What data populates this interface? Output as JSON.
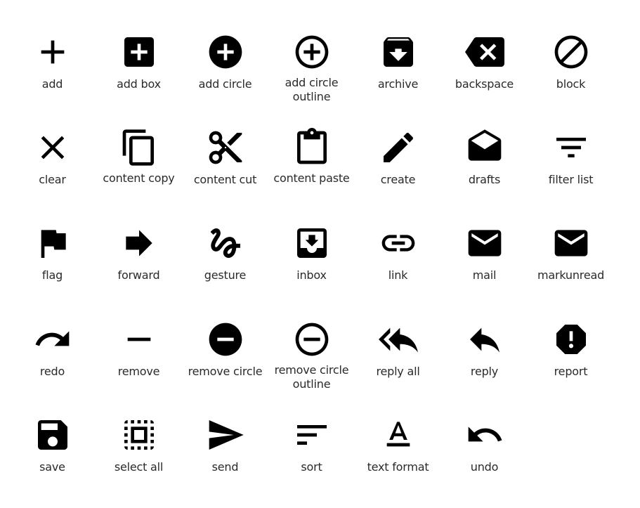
{
  "icons": [
    {
      "id": "add",
      "label": "add",
      "icon": "add-icon"
    },
    {
      "id": "add_box",
      "label": "add box",
      "icon": "add-box-icon"
    },
    {
      "id": "add_circle",
      "label": "add circle",
      "icon": "add-circle-icon"
    },
    {
      "id": "add_circle_outline",
      "label": "add circle outline",
      "icon": "add-circle-outline-icon"
    },
    {
      "id": "archive",
      "label": "archive",
      "icon": "archive-icon"
    },
    {
      "id": "backspace",
      "label": "backspace",
      "icon": "backspace-icon"
    },
    {
      "id": "block",
      "label": "block",
      "icon": "block-icon"
    },
    {
      "id": "clear",
      "label": "clear",
      "icon": "clear-icon"
    },
    {
      "id": "content_copy",
      "label": "content copy",
      "icon": "content-copy-icon"
    },
    {
      "id": "content_cut",
      "label": "content cut",
      "icon": "content-cut-icon"
    },
    {
      "id": "content_paste",
      "label": "content paste",
      "icon": "content-paste-icon"
    },
    {
      "id": "create",
      "label": "create",
      "icon": "create-icon"
    },
    {
      "id": "drafts",
      "label": "drafts",
      "icon": "drafts-icon"
    },
    {
      "id": "filter_list",
      "label": "filter list",
      "icon": "filter-list-icon"
    },
    {
      "id": "flag",
      "label": "flag",
      "icon": "flag-icon"
    },
    {
      "id": "forward",
      "label": "forward",
      "icon": "forward-icon"
    },
    {
      "id": "gesture",
      "label": "gesture",
      "icon": "gesture-icon"
    },
    {
      "id": "inbox",
      "label": "inbox",
      "icon": "inbox-icon"
    },
    {
      "id": "link",
      "label": "link",
      "icon": "link-icon"
    },
    {
      "id": "mail",
      "label": "mail",
      "icon": "mail-icon"
    },
    {
      "id": "markunread",
      "label": "markunread",
      "icon": "markunread-icon"
    },
    {
      "id": "redo",
      "label": "redo",
      "icon": "redo-icon"
    },
    {
      "id": "remove",
      "label": "remove",
      "icon": "remove-icon"
    },
    {
      "id": "remove_circle",
      "label": "remove circle",
      "icon": "remove-circle-icon"
    },
    {
      "id": "remove_circle_outline",
      "label": "remove circle outline",
      "icon": "remove-circle-outline-icon"
    },
    {
      "id": "reply_all",
      "label": "reply all",
      "icon": "reply-all-icon"
    },
    {
      "id": "reply",
      "label": "reply",
      "icon": "reply-icon"
    },
    {
      "id": "report",
      "label": "report",
      "icon": "report-icon"
    },
    {
      "id": "save",
      "label": "save",
      "icon": "save-icon"
    },
    {
      "id": "select_all",
      "label": "select all",
      "icon": "select-all-icon"
    },
    {
      "id": "send",
      "label": "send",
      "icon": "send-icon"
    },
    {
      "id": "sort",
      "label": "sort",
      "icon": "sort-icon"
    },
    {
      "id": "text_format",
      "label": "text format",
      "icon": "text-format-icon"
    },
    {
      "id": "undo",
      "label": "undo",
      "icon": "undo-icon"
    }
  ],
  "colors": {
    "icon": "#000000",
    "label": "#2a2a2a",
    "background": "#ffffff"
  }
}
